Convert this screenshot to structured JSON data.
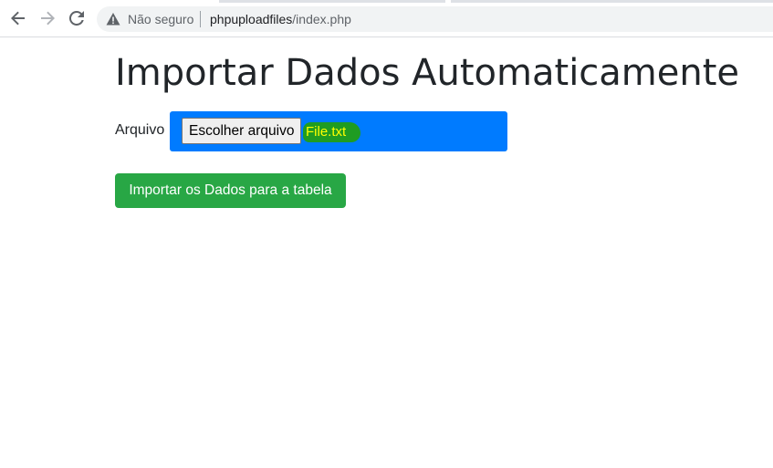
{
  "browser": {
    "security_label": "Não seguro",
    "url_host": "phpuploadfiles",
    "url_path": "/index.php",
    "icons": {
      "back": "arrow-left-icon",
      "forward": "arrow-right-icon",
      "reload": "reload-icon",
      "warning": "warning-triangle-icon"
    }
  },
  "page": {
    "title": "Importar Dados Automaticamente",
    "file_field": {
      "label": "Arquivo",
      "choose_button_label": "Escolher arquivo",
      "selected_file": "File.txt"
    },
    "import_button_label": "Importar os Dados para a tabela"
  },
  "colors": {
    "file_box_bg": "#007bff",
    "file_highlight": "#1f9c22",
    "file_name_text": "#ffff00",
    "import_button_bg": "#28a745"
  }
}
